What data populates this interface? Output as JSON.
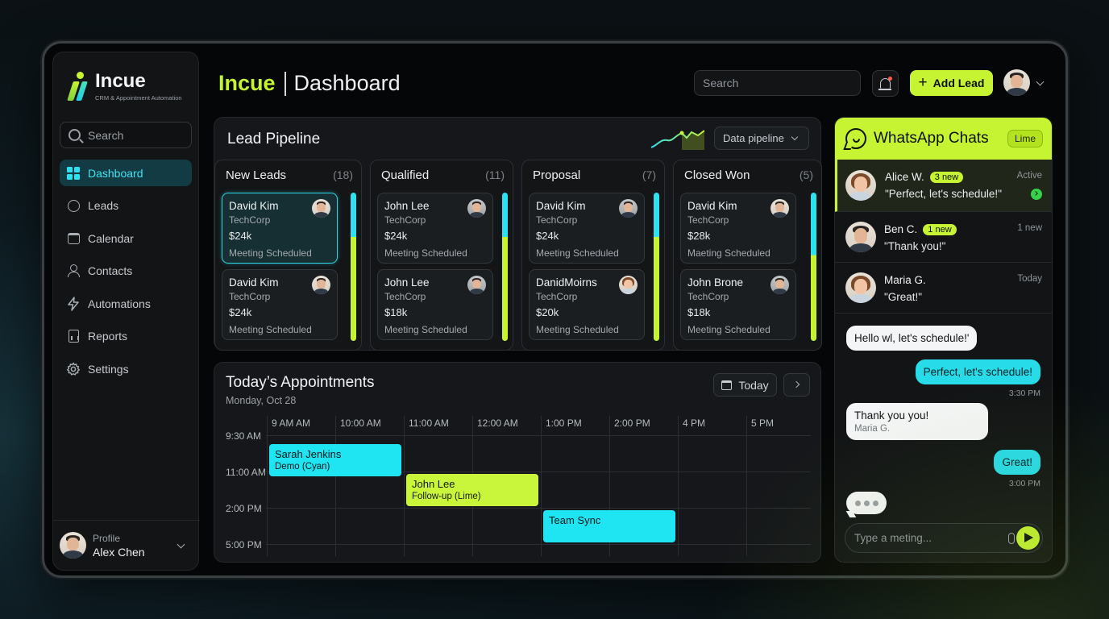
{
  "brand": {
    "name": "Incue",
    "tagline": "CRM & Appointment Automation"
  },
  "header": {
    "app": "Incue",
    "page": "Dashboard",
    "search_placeholder": "Search",
    "add_lead": "Add Lead"
  },
  "sidebar": {
    "search_placeholder": "Search",
    "items": [
      {
        "label": "Dashboard",
        "icon": "grid-icon",
        "active": true
      },
      {
        "label": "Leads",
        "icon": "check-circle-icon"
      },
      {
        "label": "Calendar",
        "icon": "calendar-icon"
      },
      {
        "label": "Contacts",
        "icon": "person-icon"
      },
      {
        "label": "Automations",
        "icon": "bolt-icon"
      },
      {
        "label": "Reports",
        "icon": "report-icon"
      },
      {
        "label": "Settings",
        "icon": "gear-icon"
      }
    ],
    "profile": {
      "label": "Profile",
      "name": "Alex Chen"
    }
  },
  "pipeline": {
    "title": "Lead Pipeline",
    "selector": "Data pipeline",
    "columns": [
      {
        "title": "New Leads",
        "count": "(18)",
        "cards": [
          {
            "name": "David Kim",
            "company": "TechCorp",
            "value": "$24k",
            "status": "Meeting Scheduled"
          },
          {
            "name": "David Kim",
            "company": "TechCorp",
            "value": "$24k",
            "status": "Meeting Scheduled"
          }
        ]
      },
      {
        "title": "Qualified",
        "count": "(11)",
        "cards": [
          {
            "name": "John Lee",
            "company": "TechCorp",
            "value": "$24k",
            "status": "Meeting Scheduled"
          },
          {
            "name": "John Lee",
            "company": "TechCorp",
            "value": "$18k",
            "status": "Meeting Scheduled"
          }
        ]
      },
      {
        "title": "Proposal",
        "count": "(7)",
        "cards": [
          {
            "name": "David Kim",
            "company": "TechCorp",
            "value": "$24k",
            "status": "Meeting Scheduled"
          },
          {
            "name": "DanidMoirns",
            "company": "TechCorp",
            "value": "$20k",
            "status": "Meeting Scheduled"
          }
        ]
      },
      {
        "title": "Closed Won",
        "count": "(5)",
        "cards": [
          {
            "name": "David Kim",
            "company": "TechCorp",
            "value": "$28k",
            "status": "Maeting Scheduled"
          },
          {
            "name": "John Brone",
            "company": "TechCorp",
            "value": "$18k",
            "status": "Meeting Scheduled"
          }
        ]
      }
    ]
  },
  "appointments": {
    "title": "Today’s Appointments",
    "date": "Monday, Oct 28",
    "today": "Today",
    "columns": [
      "9 AM AM",
      "10:00 AM",
      "11:00 AM",
      "12:00 AM",
      "1:00 PM",
      "2:00 PM",
      "4 PM",
      "5 PM"
    ],
    "rows": [
      "9:30 AM",
      "11:00 AM",
      "2:00 PM",
      "5:00 PM"
    ],
    "events": [
      {
        "title": "Sarah Jenkins",
        "sub": "Demo (Cyan)",
        "color": "#1fe4f2"
      },
      {
        "title": "John Lee",
        "sub": "Follow-up (Lime)",
        "color": "#c9f53a"
      },
      {
        "title": "Team Sync",
        "sub": "",
        "color": "#1fe4f2"
      }
    ]
  },
  "whatsapp": {
    "title": "WhatsApp Chats",
    "badge": "Lime",
    "chats": [
      {
        "name": "Alice W.",
        "badge": "3 new",
        "message": "\"Perfect, let's schedule!\"",
        "meta": "Active"
      },
      {
        "name": "Ben C.",
        "badge": "1 new",
        "message": "\"Thank you!\"",
        "meta": "1 new"
      },
      {
        "name": "Maria G.",
        "badge": "",
        "message": "\"Great!\"",
        "meta": "Today"
      }
    ],
    "messages": [
      {
        "dir": "in",
        "text": "Hello wl, let's schedule!'"
      },
      {
        "dir": "out",
        "text": "Perfect, let's schedule!",
        "time": "3:30 PM"
      },
      {
        "dir": "in",
        "text": "Thank you you!",
        "sub": "Maria G."
      },
      {
        "dir": "out",
        "text": "Great!",
        "time": "3:00 PM"
      }
    ],
    "input_placeholder": "Type a meting..."
  },
  "colors": {
    "accent_lime": "#c6f432",
    "accent_cyan": "#2fe0ee",
    "background": "#050607"
  }
}
